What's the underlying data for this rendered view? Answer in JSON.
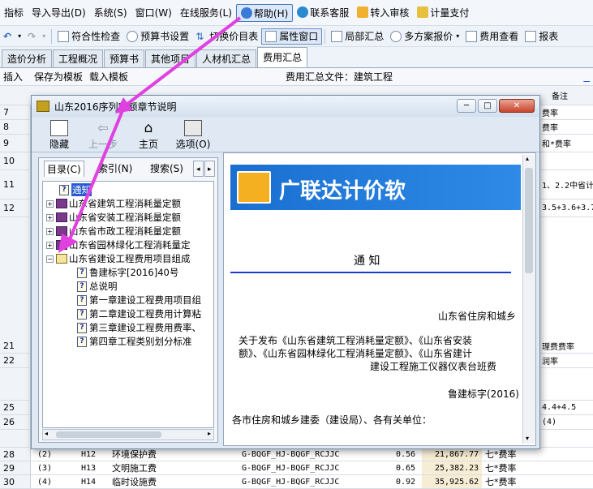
{
  "menubar": {
    "items": [
      "指标",
      "导入导出(D)",
      "系统(S)",
      "窗口(W)",
      "在线服务(L)",
      "帮助(H)",
      "联系客服",
      "转入审核",
      "计量支付"
    ]
  },
  "toolbar": {
    "items": [
      "符合性检查",
      "预算书设置",
      "切换价目表",
      "属性窗口",
      "局部汇总",
      "多方案报价",
      "费用查看",
      "报表"
    ]
  },
  "tabs": [
    "造价分析",
    "工程概况",
    "预算书",
    "其他项目",
    "人材机汇总",
    "费用汇总"
  ],
  "subbar": {
    "insert": "插入",
    "save_template": "保存为模板",
    "load_template": "载入模板",
    "file_label": "费用汇总文件：建筑工程"
  },
  "grid": {
    "header_remark": "备注",
    "rows": [
      {
        "num": "7",
        "remark": "费率"
      },
      {
        "num": "8",
        "remark": "费率"
      },
      {
        "num": "9",
        "remark": "和*费率"
      },
      {
        "num": "10",
        "remark": ""
      },
      {
        "num": "11",
        "remark": "1、2.2中省计"
      },
      {
        "num": "12",
        "remark": "3.5+3.6+3.7"
      },
      {
        "num": "21",
        "remark": "理费费率"
      },
      {
        "num": "22",
        "remark": "润率"
      },
      {
        "num": "25",
        "remark": "4.4+4.5"
      },
      {
        "num": "26",
        "remark": "(4)"
      },
      {
        "num": "28",
        "c1": "(2)",
        "c2": "H12",
        "c3": "环境保护费",
        "c4": "G-BQGF_HJ-BQGF_RCJJC",
        "c5": "0.56",
        "c6": "21,867.77",
        "remark": "七*费率"
      },
      {
        "num": "29",
        "c1": "(3)",
        "c2": "H13",
        "c3": "文明施工费",
        "c4": "G-BQGF_HJ-BQGF_RCJJC",
        "c5": "0.65",
        "c6": "25,382.23",
        "remark": "七*费率"
      },
      {
        "num": "30",
        "c1": "(4)",
        "c2": "H14",
        "c3": "临时设施费",
        "c4": "G-BQGF_HJ-BQGF_RCJJC",
        "c5": "0.92",
        "c6": "35,925.62",
        "remark": "七*费率"
      }
    ]
  },
  "dialog": {
    "title": "山东2016序列定额章节说明",
    "tools": {
      "hide": "隐藏",
      "back": "上一步",
      "home": "主页",
      "options": "选项(O)"
    },
    "tabs": {
      "contents": "目录(C)",
      "index": "索引(N)",
      "search": "搜索(S)"
    },
    "tree": {
      "notice": "通知",
      "n1": "山东省建筑工程消耗量定额",
      "n2": "山东省安装工程消耗量定额",
      "n3": "山东省市政工程消耗量定额",
      "n4": "山东省园林绿化工程消耗量定",
      "n5": "山东省建设工程费用项目组成",
      "c1": "鲁建标字[2016]40号",
      "c2": "总说明",
      "c3": "第一章建设工程费用项目组",
      "c4": "第二章建设工程费用计算粘",
      "c5": "第三章建设工程费用费率、",
      "c6": "第四章工程类别划分标准"
    },
    "doc": {
      "banner": "广联达计价软",
      "heading": "通  知",
      "dept": "山东省住房和城乡",
      "line1": "关于发布《山东省建筑工程消耗量定额》、《山东省安装",
      "line2": "额》、《山东省园林绿化工程消耗量定额》、《山东省建计",
      "line3": "建设工程施工仪器仪表台班费",
      "ref": "鲁建标字(2016)",
      "addressee": "各市住房和城乡建委（建设局）、各有关单位："
    }
  },
  "colors": {
    "accent": "#2a5bd0",
    "banner": "#1a6fd0",
    "arrow": "#e040e0"
  }
}
